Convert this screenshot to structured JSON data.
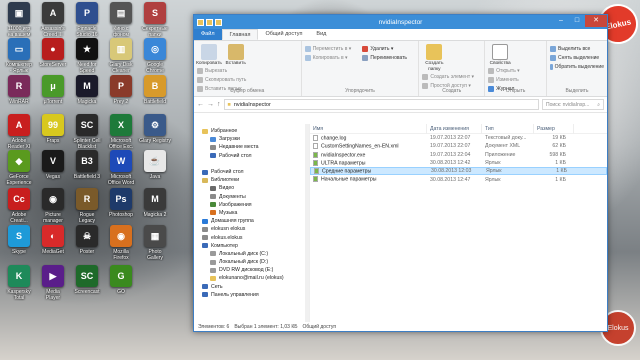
{
  "desktop": {
    "icons": [
      {
        "label": "11000 игр\nна вашем",
        "color": "#2e3b4e",
        "glyph": "▣"
      },
      {
        "label": "Assassin's\nCreed III",
        "color": "#3b3b3b",
        "glyph": "A"
      },
      {
        "label": "Pinnacle\nStudio 16",
        "color": "#2f4f8f",
        "glyph": "P"
      },
      {
        "label": "Кино с\nфоном",
        "color": "#555",
        "glyph": "▤"
      },
      {
        "label": "Секретные\nпапки",
        "color": "#b04040",
        "glyph": "S"
      },
      {
        "label": "Компьютер\n- Ярлык",
        "color": "#2a6fb8",
        "glyph": "▭"
      },
      {
        "label": "StoreServer",
        "color": "#b81d1d",
        "glyph": "●"
      },
      {
        "label": "Need for\nSpeed",
        "color": "#111",
        "glyph": "★"
      },
      {
        "label": "Glary Disk\nCleaner",
        "color": "#d8c878",
        "glyph": "▥"
      },
      {
        "label": "Google\nChrome",
        "color": "#3a87d8",
        "glyph": "◎"
      },
      {
        "label": "WinRAR",
        "color": "#7a2a5a",
        "glyph": "R"
      },
      {
        "label": "μTorrent",
        "color": "#4a9a2a",
        "glyph": "μ"
      },
      {
        "label": "Magicka",
        "color": "#1a1a2a",
        "glyph": "M"
      },
      {
        "label": "Prey 2",
        "color": "#8a3a2a",
        "glyph": "P"
      },
      {
        "label": "Battlefield",
        "color": "#d89a2a",
        "glyph": "B"
      },
      {
        "label": "Adobe\nReader XI",
        "color": "#c81e1e",
        "glyph": "A"
      },
      {
        "label": "Fraps",
        "color": "#d8c81e",
        "glyph": "99"
      },
      {
        "label": "Splinter Cell\nBlacklist",
        "color": "#2a2a2a",
        "glyph": "SC"
      },
      {
        "label": "Microsoft\nOffice Exc.",
        "color": "#1e7a3a",
        "glyph": "X"
      },
      {
        "label": "Glary Registry",
        "color": "#3a5a8a",
        "glyph": "⚙"
      },
      {
        "label": "GeForce\nExperience",
        "color": "#5a9a1e",
        "glyph": "◆"
      },
      {
        "label": "Vegas",
        "color": "#1a1a1a",
        "glyph": "V"
      },
      {
        "label": "Battlefield 3",
        "color": "#2a2a2a",
        "glyph": "B3"
      },
      {
        "label": "Microsoft\nOffice Word",
        "color": "#1e4ab8",
        "glyph": "W"
      },
      {
        "label": "Java",
        "color": "#e8e8e8",
        "glyph": "☕"
      },
      {
        "label": "Adobe\nCreati...",
        "color": "#c81e1e",
        "glyph": "Cc"
      },
      {
        "label": "Picture\nmanager",
        "color": "#2a2a2a",
        "glyph": "◉"
      },
      {
        "label": "Rogue\nLegacy",
        "color": "#7a5a2a",
        "glyph": "R"
      },
      {
        "label": "Photoshop",
        "color": "#1e3a6a",
        "glyph": "Ps"
      },
      {
        "label": "Magicka 2",
        "color": "#3a3a3a",
        "glyph": "M"
      },
      {
        "label": "Skype",
        "color": "#1e9ad8",
        "glyph": "S"
      },
      {
        "label": "MediaGet",
        "color": "#d82a2a",
        "glyph": "◐"
      },
      {
        "label": "Poster",
        "color": "#2a2a2a",
        "glyph": "☠"
      },
      {
        "label": "Mozilla\nFirefox",
        "color": "#d8701e",
        "glyph": "◉"
      },
      {
        "label": "Photo\nGallery",
        "color": "#4a4a4a",
        "glyph": "▦"
      },
      {
        "label": "Kaspersky\nTotal",
        "color": "#1e8a5a",
        "glyph": "K"
      },
      {
        "label": "Media\nPlayer",
        "color": "#5a1e8a",
        "glyph": "▶"
      },
      {
        "label": "Screencast",
        "color": "#1e6a2a",
        "glyph": "SC"
      },
      {
        "label": "GO",
        "color": "#3a8a1e",
        "glyph": "G"
      }
    ],
    "logo": "Elokus"
  },
  "window": {
    "title": "nvidiaInspector",
    "tabs": [
      "Файл",
      "Главная",
      "Общий доступ",
      "Вид"
    ],
    "ribbon": {
      "clipboard": {
        "group": "Буфер обмена",
        "copy": "Копировать",
        "paste": "Вставить",
        "cut": "Вырезать",
        "copy_path": "Скопировать путь",
        "paste_shortcut": "Вставить ярлык"
      },
      "organize": {
        "group": "Упорядочить",
        "move": "Переместить в ▾",
        "copy": "Копировать в ▾",
        "delete": "Удалить ▾",
        "rename": "Переименовать"
      },
      "create": {
        "group": "Создать",
        "new_folder": "Создать\nпапку",
        "new_item": "Создать элемент ▾",
        "easy_access": "Простой доступ ▾"
      },
      "open": {
        "group": "Открыть",
        "properties": "Свойства",
        "open": "Открыть ▾",
        "edit": "Изменить",
        "journal": "Журнал"
      },
      "select": {
        "group": "Выделить",
        "all": "Выделить все",
        "none": "Снять выделение",
        "invert": "Обратить выделение"
      }
    },
    "address": "nvidiaInspector",
    "search_placeholder": "Поиск: nvidiaInsp...",
    "tree": [
      {
        "label": "Избранное",
        "color": "#e8c35a"
      },
      {
        "label": "Загрузки",
        "color": "#4a8ad8"
      },
      {
        "label": "Недавние места",
        "color": "#8a8a8a"
      },
      {
        "label": "Рабочий стол",
        "color": "#3a6ab8"
      },
      {
        "label": "",
        "color": "transparent"
      },
      {
        "label": "Рабочий стол",
        "color": "#3a6ab8"
      },
      {
        "label": "Библиотеки",
        "color": "#d8b85a"
      },
      {
        "label": "Видео",
        "color": "#6a6a6a"
      },
      {
        "label": "Документы",
        "color": "#8a8a8a"
      },
      {
        "label": "Изображения",
        "color": "#4a8a3a"
      },
      {
        "label": "Музыка",
        "color": "#d8701e"
      },
      {
        "label": "Домашняя группа",
        "color": "#2a7ad8"
      },
      {
        "label": "elokusn elokus",
        "color": "#8a8a8a"
      },
      {
        "label": "elokus.elokus",
        "color": "#8a8a8a"
      },
      {
        "label": "Компьютер",
        "color": "#3a6ab8"
      },
      {
        "label": "Локальный диск (C:)",
        "color": "#9a9a9a"
      },
      {
        "label": "Локальный диск (D:)",
        "color": "#9a9a9a"
      },
      {
        "label": "DVD RW дисковод (E:)",
        "color": "#9a9a9a"
      },
      {
        "label": "elokunano@mail.ru (elokus)",
        "color": "#e8c35a"
      },
      {
        "label": "Сеть",
        "color": "#3a6ab8"
      },
      {
        "label": "Панель управления",
        "color": "#3a6ab8"
      }
    ],
    "columns": [
      "Имя",
      "Дата изменения",
      "Тип",
      "Размер"
    ],
    "files": [
      {
        "name": "change.log",
        "date": "19.07.2013 22:07",
        "type": "Текстовый доку...",
        "size": "19 КБ",
        "sel": false,
        "icon": "#fff"
      },
      {
        "name": "CustomSettingNames_en-EN.xml",
        "date": "19.07.2013 22:07",
        "type": "Документ XML",
        "size": "62 КБ",
        "sel": false,
        "icon": "#fff"
      },
      {
        "name": "nvidiaInspector.exe",
        "date": "19.07.2013 22:04",
        "type": "Приложение",
        "size": "598 КБ",
        "sel": false,
        "icon": "#7bb84a"
      },
      {
        "name": "ULTRA параметры",
        "date": "30.08.2013 12:42",
        "type": "Ярлык",
        "size": "1 КБ",
        "sel": false,
        "icon": "#7bb84a"
      },
      {
        "name": "Средние параметры",
        "date": "30.08.2013 12:03",
        "type": "Ярлык",
        "size": "1 КБ",
        "sel": true,
        "icon": "#7bb84a"
      },
      {
        "name": "Начальные параметры",
        "date": "30.08.2013 12:47",
        "type": "Ярлык",
        "size": "1 КБ",
        "sel": false,
        "icon": "#7bb84a"
      }
    ],
    "status": {
      "count": "Элементов: 6",
      "selected": "Выбран 1 элемент: 1,03 КБ",
      "shared": "Общий доступ"
    }
  }
}
